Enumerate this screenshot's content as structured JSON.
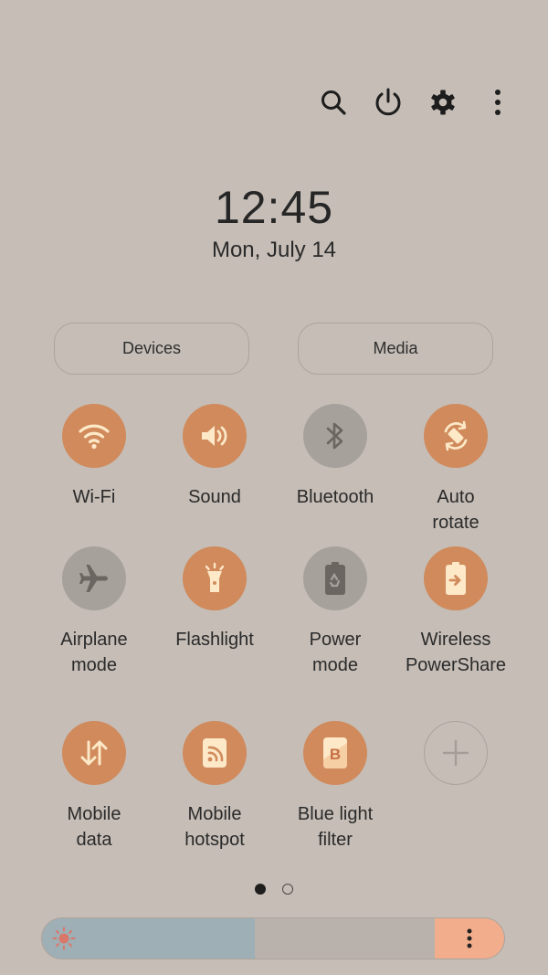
{
  "top_actions": [
    {
      "name": "search-icon"
    },
    {
      "name": "power-icon"
    },
    {
      "name": "settings-icon"
    },
    {
      "name": "more-vert-icon"
    }
  ],
  "time": "12:45",
  "date": "Mon, July 14",
  "pills": {
    "devices": "Devices",
    "media": "Media"
  },
  "tiles": [
    {
      "label": "Wi-Fi",
      "icon": "wifi-icon",
      "state": "on"
    },
    {
      "label": "Sound",
      "icon": "speaker-icon",
      "state": "on"
    },
    {
      "label": "Bluetooth",
      "icon": "bluetooth-icon",
      "state": "off"
    },
    {
      "label": "Auto\nrotate",
      "icon": "auto-rotate-icon",
      "state": "on"
    },
    {
      "label": "Airplane\nmode",
      "icon": "airplane-icon",
      "state": "off"
    },
    {
      "label": "Flashlight",
      "icon": "flashlight-icon",
      "state": "on"
    },
    {
      "label": "Power\nmode",
      "icon": "battery-recycle-icon",
      "state": "off"
    },
    {
      "label": "Wireless\nPowerShare",
      "icon": "powershare-icon",
      "state": "on"
    },
    {
      "label": "Mobile\ndata",
      "icon": "up-down-arrows-icon",
      "state": "on"
    },
    {
      "label": "Mobile\nhotspot",
      "icon": "hotspot-icon",
      "state": "on"
    },
    {
      "label": "Blue light\nfilter",
      "icon": "blue-light-filter-icon",
      "state": "on"
    },
    {
      "label": "",
      "icon": "add-icon",
      "state": "add"
    }
  ],
  "pages": {
    "count": 2,
    "active": 0
  },
  "brightness": {
    "level": 0.46
  },
  "colors": {
    "background": "#c5bdb6",
    "tile_on": "#d08a5c",
    "tile_off": "#a7a19c",
    "icon_on": "#fde8c7",
    "icon_off": "#6b6661",
    "brightness_fill": "#9eafb5",
    "brightness_more": "#f1ad8c",
    "sun": "#d9786a"
  }
}
